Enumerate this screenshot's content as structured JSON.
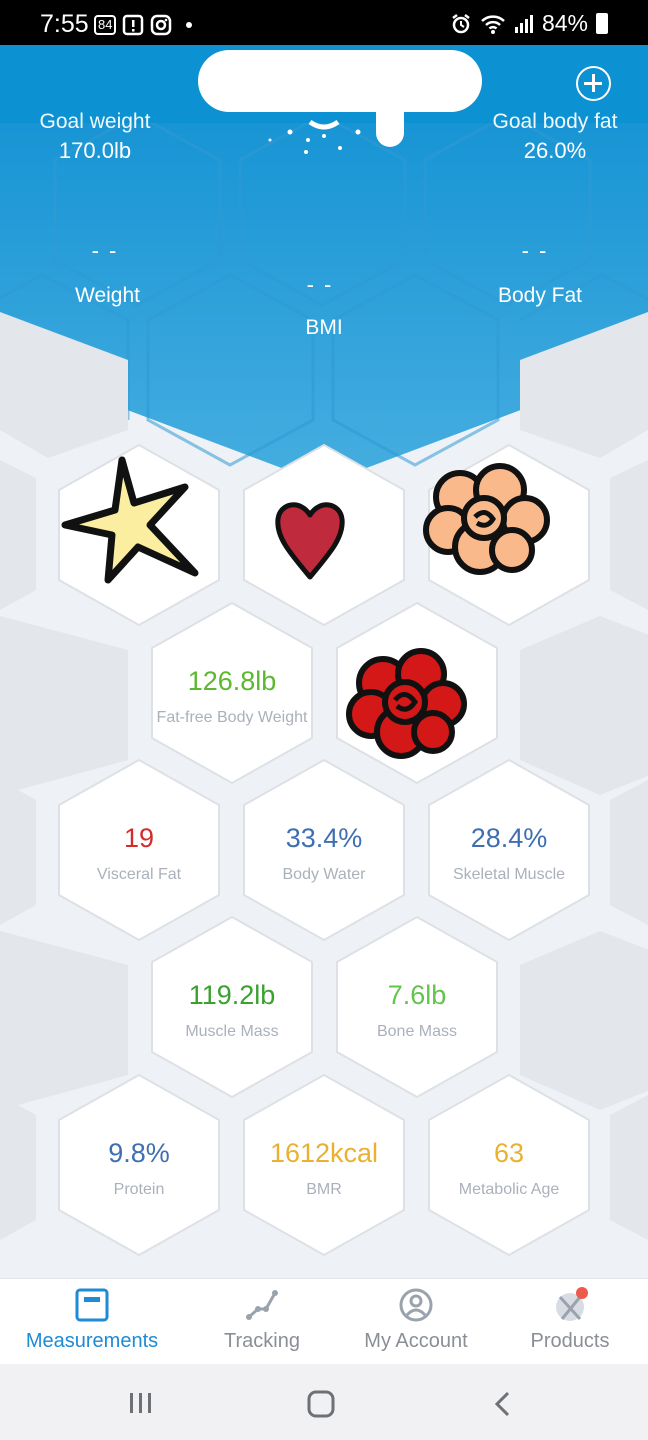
{
  "status_bar": {
    "time": "7:55",
    "chip_text": "84",
    "battery": "84%",
    "icons": [
      "alert-box-icon",
      "instagram-icon",
      "alarm-icon",
      "wifi-icon",
      "signal-icon",
      "battery-icon"
    ]
  },
  "header": {
    "goal_weight_label": "Goal weight",
    "goal_weight_value": "170.0lb",
    "goal_body_fat_label": "Goal body fat",
    "goal_body_fat_value": "26.0%",
    "weight_value": "- -",
    "weight_label": "Weight",
    "bmi_value": "- -",
    "bmi_label": "BMI",
    "body_fat_value": "- -",
    "body_fat_label": "Body Fat"
  },
  "metrics": [
    {
      "value": "126.8lb",
      "label": "Fat-free Body Weight",
      "color": "#5cb82d"
    },
    {
      "value": "19",
      "label": "Visceral Fat",
      "color": "#d42b2b"
    },
    {
      "value": "33.4%",
      "label": "Body Water",
      "color": "#3f6fb0"
    },
    {
      "value": "28.4%",
      "label": "Skeletal Muscle",
      "color": "#3f6fb0"
    },
    {
      "value": "119.2lb",
      "label": "Muscle Mass",
      "color": "#3aa030"
    },
    {
      "value": "7.6lb",
      "label": "Bone Mass",
      "color": "#62c44c"
    },
    {
      "value": "9.8%",
      "label": "Protein",
      "color": "#3f6fb0"
    },
    {
      "value": "1612kcal",
      "label": "BMR",
      "color": "#e9b12f"
    },
    {
      "value": "63",
      "label": "Metabolic Age",
      "color": "#e9b12f"
    }
  ],
  "nav": [
    {
      "label": "Measurements",
      "icon": "scale-icon",
      "active": true
    },
    {
      "label": "Tracking",
      "icon": "chart-line-icon",
      "active": false
    },
    {
      "label": "My Account",
      "icon": "user-circle-icon",
      "active": false
    },
    {
      "label": "Products",
      "icon": "products-icon",
      "active": false
    }
  ],
  "colors": {
    "header_blue": "#0c92d2",
    "accent": "#1e8bd6"
  }
}
